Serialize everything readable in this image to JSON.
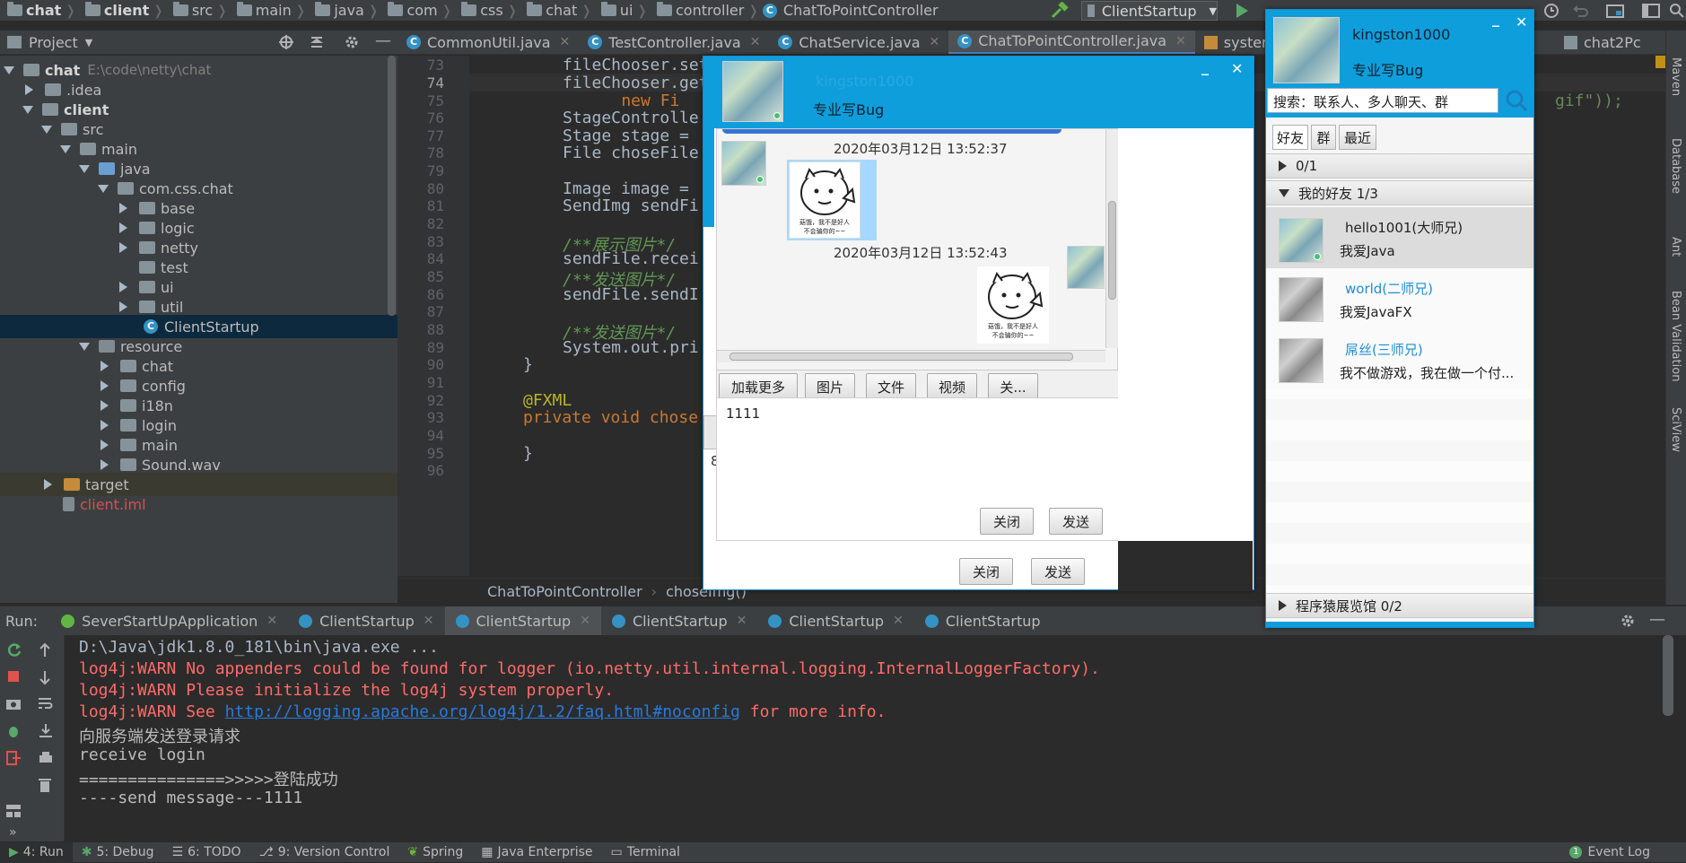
{
  "navbar": {
    "crumbs": [
      "chat",
      "client",
      "src",
      "main",
      "java",
      "com",
      "css",
      "chat",
      "ui",
      "controller",
      "ChatToPointController"
    ],
    "run_config": "ClientStartup"
  },
  "project": {
    "title": "Project",
    "tree": [
      {
        "label": "chat",
        "extra": "E:\\code\\netty\\chat"
      },
      {
        "label": ".idea"
      },
      {
        "label": "client"
      },
      {
        "label": "src"
      },
      {
        "label": "main"
      },
      {
        "label": "java"
      },
      {
        "label": "com.css.chat"
      },
      {
        "label": "base"
      },
      {
        "label": "logic"
      },
      {
        "label": "netty"
      },
      {
        "label": "test"
      },
      {
        "label": "ui"
      },
      {
        "label": "util"
      },
      {
        "label": "ClientStartup"
      },
      {
        "label": "resource"
      },
      {
        "label": "chat"
      },
      {
        "label": "config"
      },
      {
        "label": "i18n"
      },
      {
        "label": "login"
      },
      {
        "label": "main"
      },
      {
        "label": "Sound.wav"
      },
      {
        "label": "target"
      },
      {
        "label": "client.iml"
      }
    ]
  },
  "editor": {
    "tabs": [
      "CommonUtil.java",
      "TestController.java",
      "ChatService.java",
      "ChatToPointController.java",
      "systemCon",
      "chat2Pc"
    ],
    "line_numbers": [
      "73",
      "74",
      "75",
      "76",
      "77",
      "78",
      "79",
      "80",
      "81",
      "82",
      "83",
      "84",
      "85",
      "86",
      "87",
      "88",
      "89",
      "90",
      "91",
      "92",
      "93",
      "94",
      "95",
      "96"
    ],
    "code": [
      "fileChooser.set",
      "fileChooser.get",
      "    new Fi",
      "StageControlle",
      "Stage stage =",
      "File choseFile",
      "",
      "Image image =",
      "SendImg sendFi",
      "",
      "/**展示图片*/",
      "sendFile.recei",
      "/**发送图片*/",
      "sendFile.sendI",
      "",
      "/**发送图片*/",
      "System.out.pri",
      "}",
      "",
      "@FXML",
      "private void chose",
      "",
      "}",
      ""
    ],
    "code_top_partial": "fileChooser.set",
    "right_fragment_gif": "gif\"));",
    "right_fragment_o": "o",
    "right_fragment_paren": "(",
    "right_fragment_e": "e",
    "breadcrumb": [
      "ChatToPointController",
      "choseImg()"
    ]
  },
  "run": {
    "label": "Run:",
    "tabs": [
      "SeverStartUpApplication",
      "ClientStartup",
      "ClientStartup",
      "ClientStartup",
      "ClientStartup",
      "ClientStartup"
    ],
    "console": [
      {
        "text": "D:\\Java\\jdk1.8.0_181\\bin\\java.exe ...",
        "style": "gray"
      },
      {
        "text": "log4j:WARN No appenders could be found for logger (io.netty.util.internal.logging.InternalLoggerFactory).",
        "style": "red"
      },
      {
        "text": "log4j:WARN Please initialize the log4j system properly.",
        "style": "red"
      },
      {
        "text_before": "log4j:WARN See ",
        "link": "http://logging.apache.org/log4j/1.2/faq.html#noconfig",
        "text_after": " for more info.",
        "style": "red"
      },
      {
        "text": "向服务端发送登录请求",
        "style": "normal"
      },
      {
        "text": "receive login",
        "style": "normal"
      },
      {
        "text": "===============>>>>>登陆成功",
        "style": "normal"
      },
      {
        "text": "----send message---1111",
        "style": "normal"
      }
    ]
  },
  "statusbar": {
    "items": [
      "4: Run",
      "5: Debug",
      "6: TODO",
      "9: Version Control",
      "Spring",
      "Java Enterprise",
      "Terminal"
    ],
    "event_count": "1",
    "event_log": "Event Log"
  },
  "right_strip": [
    "Maven",
    "Database",
    "Ant",
    "Bean Validation",
    "SciView"
  ],
  "chat_window": {
    "user_name": "kingston1000",
    "signature": "专业写Bug",
    "messages": [
      {
        "time": "2020年03月12日  13:52:37",
        "side": "left"
      },
      {
        "time": "2020年03月12日  13:52:43",
        "side": "right"
      }
    ],
    "meme_caption": "菇饿，我不是好人\n不会骗你的~~",
    "toolbar": [
      "加载更多",
      "图片",
      "文件",
      "视频",
      "关..."
    ],
    "input_text": "1111",
    "inner_close": "关闭",
    "inner_send": "发送",
    "outer_close": "关闭",
    "outer_send": "发送",
    "bg_digit": "8"
  },
  "friend_list": {
    "user_name": "kingston1000",
    "signature": "专业写Bug",
    "search_placeholder": "搜索：联系人、多人聊天、群",
    "tabs": [
      "好友",
      "群",
      "最近"
    ],
    "groups": [
      {
        "label": "0/1",
        "expanded": false
      },
      {
        "label": "我的好友 1/3",
        "expanded": true
      },
      {
        "label": "程序猿展览馆 0/2",
        "expanded": false
      }
    ],
    "friends": [
      {
        "name": "hello1001(大师兄)",
        "signature": "我爱Java",
        "online": true,
        "selected": true
      },
      {
        "name": "world(二师兄)",
        "signature": "我爱JavaFX",
        "online": false,
        "selected": false
      },
      {
        "name": "屌丝(三师兄)",
        "signature": "我不做游戏，我在做一个付...",
        "online": false,
        "selected": false
      }
    ]
  },
  "colors": {
    "ide_bg": "#2b2b2b",
    "panel_bg": "#3c3f41",
    "chat_header": "#0e9edb",
    "console_red": "#ff6b68",
    "link": "#287bde",
    "friend_offline_name": "#1e8fd1"
  }
}
